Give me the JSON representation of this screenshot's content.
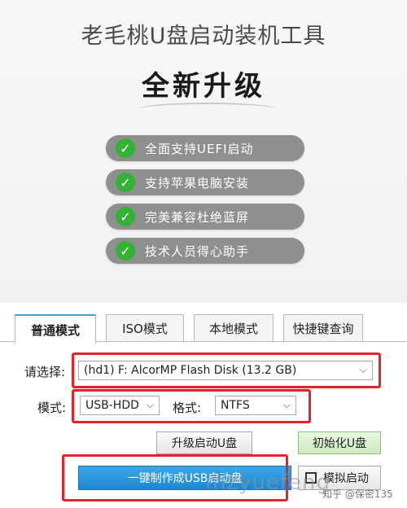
{
  "header": {
    "title": "老毛桃U盘启动装机工具",
    "subtitle": "全新升级"
  },
  "features": [
    {
      "text": "全面支持UEFI启动",
      "icon": "check-icon"
    },
    {
      "text": "支持苹果电脑安装",
      "icon": "check-icon"
    },
    {
      "text": "完美兼容杜绝蓝屏",
      "icon": "check-icon"
    },
    {
      "text": "技术人员得心助手",
      "icon": "check-icon"
    }
  ],
  "tabs": [
    {
      "label": "普通模式",
      "active": true
    },
    {
      "label": "ISO模式",
      "active": false
    },
    {
      "label": "本地模式",
      "active": false
    },
    {
      "label": "快捷键查询",
      "active": false
    }
  ],
  "form": {
    "select_label": "请选择:",
    "disk_value": "(hd1) F: AlcorMP Flash Disk (13.2 GB)",
    "mode_label": "模式:",
    "mode_value": "USB-HDD",
    "format_label": "格式:",
    "format_value": "NTFS"
  },
  "buttons": {
    "upgrade": "升级启动U盘",
    "init": "初始化U盘",
    "make": "一键制作成USB启动盘",
    "simulate": "模拟启动"
  },
  "colors": {
    "accent": "#1f86cf",
    "check": "#34b233",
    "highlight": "#e0262a"
  },
  "watermark": {
    "text": "mzyuefeng",
    "credit": "知乎 @保密135"
  }
}
